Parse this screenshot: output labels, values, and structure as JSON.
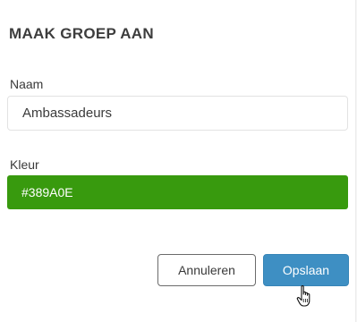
{
  "dialog": {
    "title": "MAAK GROEP AAN",
    "name_label": "Naam",
    "name_value": "Ambassadeurs",
    "color_label": "Kleur",
    "color_value": "#389A0E",
    "cancel_label": "Annuleren",
    "save_label": "Opslaan"
  },
  "colors": {
    "selected_color": "#389A0E",
    "save_button": "#3e8fc3"
  },
  "icons": {
    "cursor": "hand-pointer-icon"
  }
}
